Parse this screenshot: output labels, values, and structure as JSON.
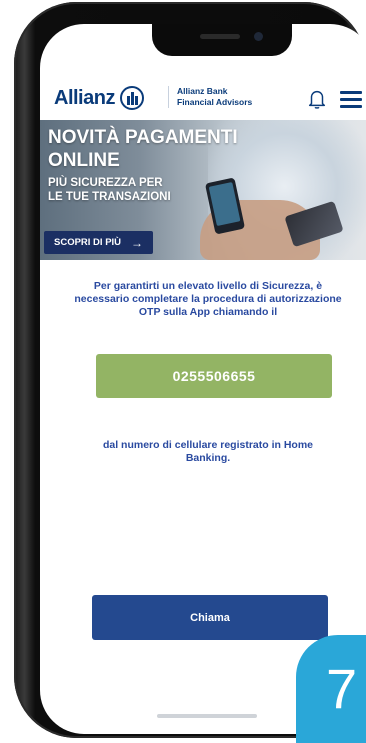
{
  "header": {
    "brand_name": "Allianz",
    "sub_brand_line1": "Allianz Bank",
    "sub_brand_line2": "Financial Advisors",
    "bell_icon": "bell-icon",
    "menu_icon": "hamburger-menu-icon",
    "brand_color": "#0a3b7a"
  },
  "banner": {
    "title_line1": "NOVITÀ PAGAMENTI",
    "title_line2": "ONLINE",
    "subtitle_line1": "PIÙ SICUREZZA PER",
    "subtitle_line2": "LE TUE TRANSAZIONI",
    "cta_label": "SCOPRI DI PIÙ",
    "cta_arrow": "→",
    "cta_color": "#1b2f63"
  },
  "body": {
    "message": "Per garantirti un elevato livello di Sicurezza, è necessario completare la procedura di autorizzazione OTP sulla App chiamando il",
    "phone_number": "0255506655",
    "phone_number_color": "#93b464",
    "note": "dal numero di cellulare registrato in Home Banking.",
    "call_button_label": "Chiama",
    "call_button_color": "#24498f",
    "text_color": "#2a4aa0"
  },
  "step_badge": {
    "number": "7",
    "color": "#2aa7d8"
  }
}
